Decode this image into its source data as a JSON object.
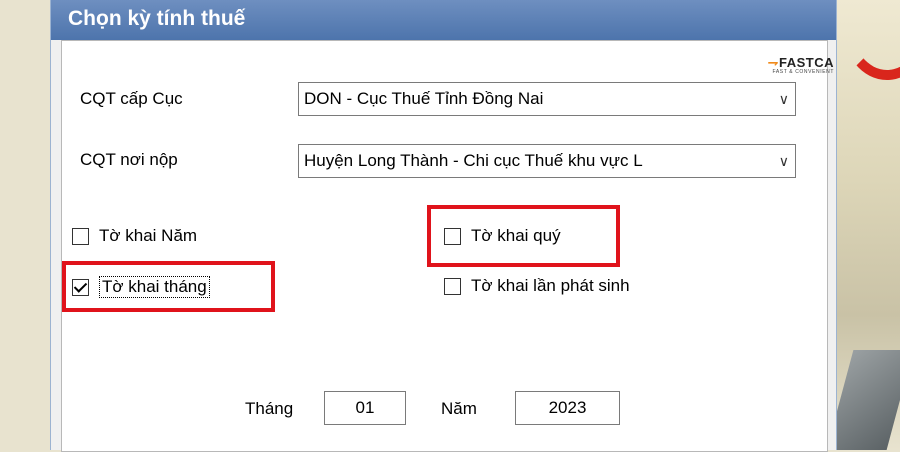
{
  "window": {
    "title": "Chọn kỳ tính thuế"
  },
  "logo": {
    "brand": "FASTCA",
    "tagline": "FAST & CONVENIENT"
  },
  "form": {
    "cqt_cuc_label": "CQT cấp Cục",
    "cqt_cuc_value": "DON - Cục Thuế Tỉnh Đồng Nai",
    "cqt_noi_nop_label": "CQT nơi nộp",
    "cqt_noi_nop_value": "Huyện Long Thành - Chi cục Thuế khu vực L",
    "dropdown_icon": "chevron-down-icon"
  },
  "options": {
    "to_khai_nam": {
      "label": "Tờ khai Năm",
      "checked": false
    },
    "to_khai_quy": {
      "label": "Tờ khai quý",
      "checked": false
    },
    "to_khai_thang": {
      "label": "Tờ khai tháng",
      "checked": true
    },
    "to_khai_lan_phat_sinh": {
      "label": "Tờ khai lần phát sinh",
      "checked": false
    }
  },
  "period": {
    "month_label": "Tháng",
    "month_value": "01",
    "year_label": "Năm",
    "year_value": "2023"
  },
  "colors": {
    "titlebar": "#5b80b6",
    "highlight": "#e0131b"
  }
}
